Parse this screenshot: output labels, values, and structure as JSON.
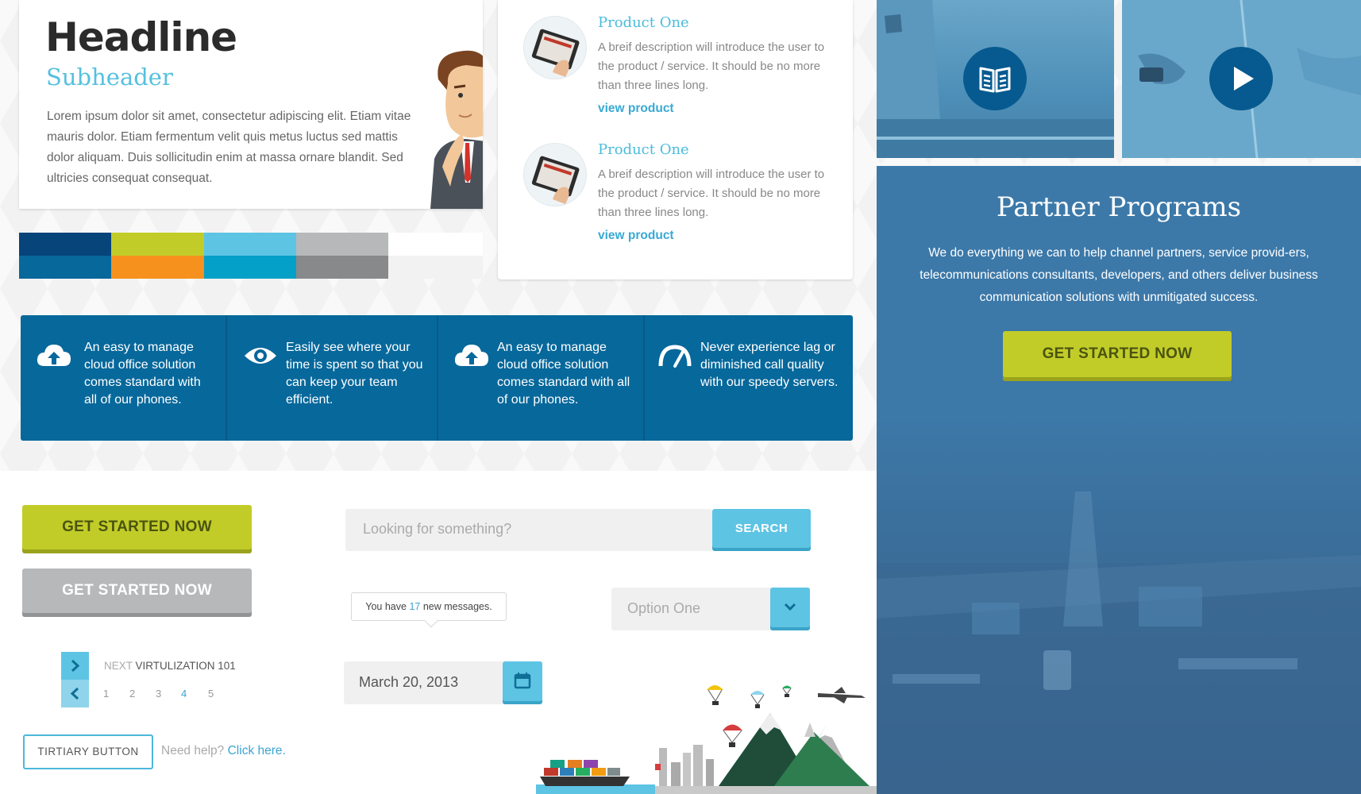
{
  "hero": {
    "headline": "Headline",
    "subheader": "Subheader",
    "body": "Lorem ipsum dolor sit amet, consectetur adipiscing elit. Etiam vitae mauris dolor. Etiam fermentum velit quis metus luctus sed mattis dolor aliquam. Duis sollicitudin enim at massa ornare blandit. Sed ultricies consequat consequat."
  },
  "palette": {
    "top": [
      "#06447a",
      "#c2cc29",
      "#5ec4e4",
      "#b7b8ba",
      "#ffffff"
    ],
    "bottom": [
      "#07689b",
      "#f6911e",
      "#04a0c8",
      "#88898b",
      "#f2f2f2"
    ]
  },
  "products": [
    {
      "title": "Product One",
      "description": "A breif description will introduce the user to the product / service. It should be no more than three lines long.",
      "link": "view product"
    },
    {
      "title": "Product One",
      "description": "A breif description will introduce the user to the product / service. It should be no more than three lines long.",
      "link": "view product"
    }
  ],
  "media": {
    "left_icon": "book-icon",
    "right_icon": "play-icon"
  },
  "partner": {
    "title": "Partner Programs",
    "body": "We do everything we can to help channel partners, service provid-ers, telecommunications consultants, developers, and others deliver business communication solutions with unmitigated success.",
    "cta": "GET STARTED NOW"
  },
  "features": [
    {
      "icon": "cloud-upload-icon",
      "text": "An easy to manage cloud office solution comes standard with all of our phones."
    },
    {
      "icon": "eye-icon",
      "text": "Easily see where your time is spent so that you can keep your team efficient."
    },
    {
      "icon": "cloud-upload-icon",
      "text": "An easy to manage cloud office solution comes standard with all of our phones."
    },
    {
      "icon": "speedometer-icon",
      "text": "Never experience lag or diminished call quality with our speedy servers."
    }
  ],
  "buttons": {
    "primary": "GET STARTED NOW",
    "secondary": "GET STARTED NOW",
    "tertiary": "TIRTIARY BUTTON"
  },
  "help": {
    "prefix": "Need help?",
    "link": "Click here."
  },
  "search": {
    "placeholder": "Looking for something?",
    "button": "SEARCH"
  },
  "notification": {
    "prefix": "You have",
    "count": "17",
    "suffix": "new messages."
  },
  "select": {
    "value": "Option One"
  },
  "date": {
    "value": "March 20, 2013"
  },
  "pagination": {
    "next_label": "NEXT",
    "next_title": "VIRTULIZATION 101",
    "pages": [
      "1",
      "2",
      "3",
      "4",
      "5"
    ],
    "current": "4"
  },
  "colors": {
    "primary_blue": "#07689b",
    "light_blue": "#5ec4e4",
    "lime": "#c2cc29"
  }
}
